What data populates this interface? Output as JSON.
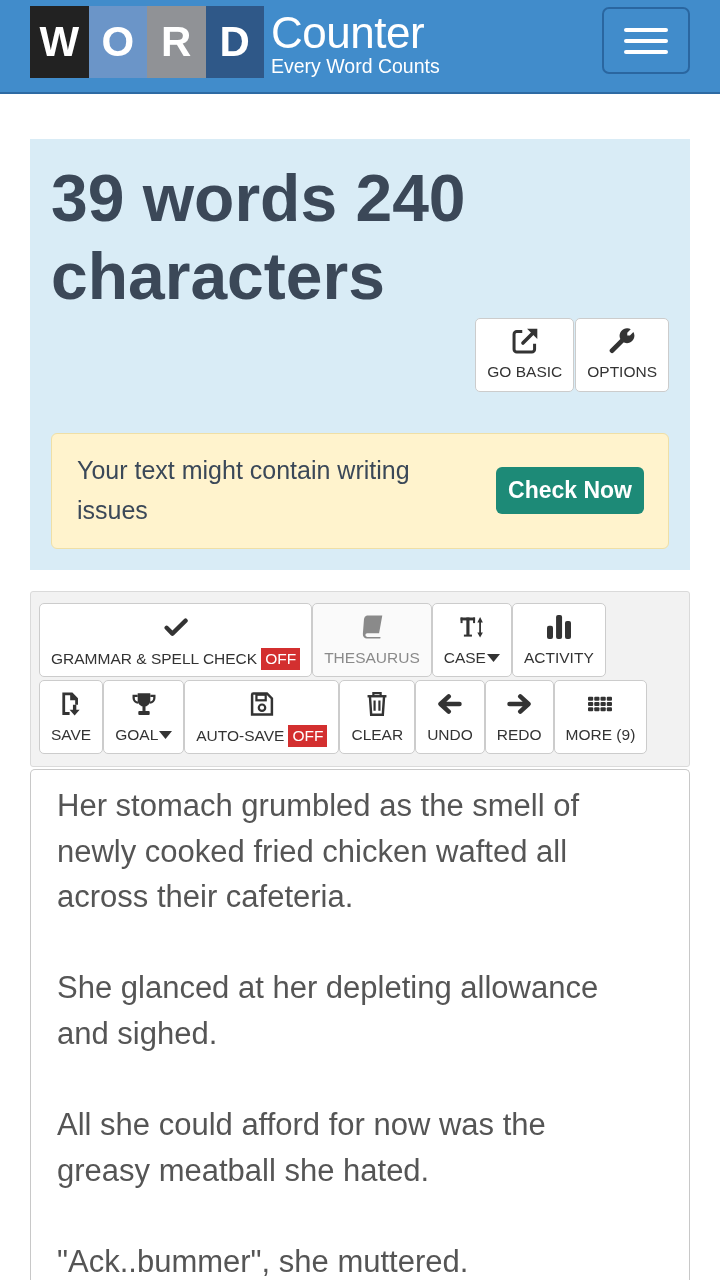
{
  "header": {
    "logo_letters": [
      {
        "letter": "W",
        "color": "#222222"
      },
      {
        "letter": "O",
        "color": "#6b95c8"
      },
      {
        "letter": "R",
        "color": "#909296"
      },
      {
        "letter": "D",
        "color": "#2f5888"
      }
    ],
    "logo_title": "Counter",
    "logo_tagline": "Every Word Counts"
  },
  "stats": {
    "headline": "39 words 240 characters",
    "buttons": [
      {
        "kind": "external",
        "label": "GO BASIC"
      },
      {
        "kind": "wrench",
        "label": "OPTIONS"
      }
    ]
  },
  "alert": {
    "message": "Your text might contain writing issues",
    "button": "Check Now"
  },
  "toolbar": {
    "rows": [
      {
        "buttons": [
          {
            "kind": "check",
            "label": "GRAMMAR & SPELL CHECK",
            "badge": "OFF",
            "disabled": false,
            "dropdown": false
          },
          {
            "kind": "book",
            "label": "THESAURUS",
            "disabled": true,
            "dropdown": false
          },
          {
            "kind": "text-size",
            "label": "CASE",
            "disabled": false,
            "dropdown": true
          },
          {
            "kind": "bar-chart",
            "label": "ACTIVITY",
            "disabled": false,
            "dropdown": false
          }
        ]
      },
      {
        "buttons": [
          {
            "kind": "file-download",
            "label": "SAVE",
            "disabled": false,
            "dropdown": false
          },
          {
            "kind": "trophy",
            "label": "GOAL",
            "disabled": false,
            "dropdown": true
          },
          {
            "kind": "floppy",
            "label": "AUTO-SAVE",
            "badge": "OFF",
            "disabled": false,
            "dropdown": false
          },
          {
            "kind": "trash",
            "label": "CLEAR",
            "disabled": false,
            "dropdown": false
          },
          {
            "kind": "arrow-left",
            "label": "UNDO",
            "disabled": false,
            "dropdown": false
          },
          {
            "kind": "arrow-right",
            "label": "REDO",
            "disabled": false,
            "dropdown": false
          },
          {
            "kind": "grid",
            "label": "MORE (9)",
            "disabled": false,
            "dropdown": false
          }
        ]
      }
    ]
  },
  "editor": {
    "paragraphs": [
      "Her stomach grumbled as the smell of newly cooked fried chicken wafted all across their cafeteria.",
      "She glanced at her depleting allowance and sighed.",
      "All she could afford for now was the greasy meatball she hated.",
      "\"Ack..bummer\", she muttered."
    ]
  }
}
